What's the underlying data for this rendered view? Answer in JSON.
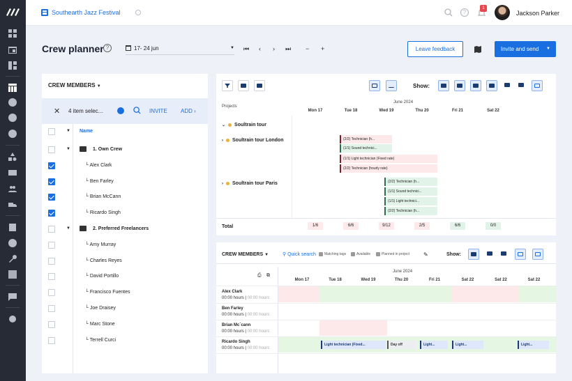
{
  "topbar": {
    "app_title": "Southearth Jazz Festival",
    "notifications": "1",
    "user_name": "Jackson Parker"
  },
  "header": {
    "title": "Crew planner",
    "date_range": "17- 24 jun",
    "nav": [
      "⏮",
      "‹",
      "›",
      "⏭",
      "−",
      "+"
    ],
    "feedback_label": "Leave feedback",
    "invite_label": "Invite and send"
  },
  "crew_panel": {
    "title": "CREW MEMBERS",
    "selection_text": "4 item selec...",
    "invite_label": "INVITE",
    "add_label": "ADD",
    "column_name": "Name",
    "rows": [
      {
        "label": "1. Own Crew",
        "group": true,
        "checked": false
      },
      {
        "label": "└ Alex Clark",
        "group": false,
        "checked": true
      },
      {
        "label": "└ Ben Farley",
        "group": false,
        "checked": true
      },
      {
        "label": "└ Brian McCann",
        "group": false,
        "checked": true
      },
      {
        "label": "└ Ricardo Singh",
        "group": false,
        "checked": true
      },
      {
        "label": "2. Preferred Freelancers",
        "group": true,
        "checked": false
      },
      {
        "label": "└ Amy Murray",
        "group": false,
        "checked": false
      },
      {
        "label": "└ Charles Reyes",
        "group": false,
        "checked": false
      },
      {
        "label": "└ David Portillo",
        "group": false,
        "checked": false
      },
      {
        "label": "└ Francisco Fuentes",
        "group": false,
        "checked": false
      },
      {
        "label": "└ Joe Draisey",
        "group": false,
        "checked": false
      },
      {
        "label": "└ Marc Stone",
        "group": false,
        "checked": false
      },
      {
        "label": "└ Terrell Curci",
        "group": false,
        "checked": false
      }
    ]
  },
  "projects_panel": {
    "show_label": "Show:",
    "projects_label": "Projects",
    "month": "June 2024",
    "days": [
      "Mon 17",
      "Tue 18",
      "Wed 19",
      "Thu 20",
      "Fri 21",
      "Sat 22"
    ],
    "projects": [
      "Soultrain tour",
      "Soultrain tour London",
      "Soultrain tour Paris"
    ],
    "london_bars": [
      "(2/2) Technician (h...",
      "(1/1) Sound technici...",
      "(1/1) Light technician (Fixed rate)",
      "(2/2) Technician (hourly rate)"
    ],
    "paris_bars": [
      "(2/2) Technician (h...",
      "(1/1) Sound technici...",
      "(1/1) Light technici...",
      "(2/2) Technician (h..."
    ],
    "total_label": "Total",
    "totals": [
      "1/6",
      "6/6",
      "9/12",
      "2/5",
      "6/6",
      "0/0"
    ]
  },
  "crew_schedule": {
    "title": "CREW MEMBERS",
    "quick_search": "Quick search",
    "tags": [
      "Matching tags",
      "Available",
      "Planned in project"
    ],
    "show_label": "Show:",
    "month": "June 2024",
    "days": [
      "Mon 17",
      "Tue 18",
      "Wed 19",
      "Thu 20",
      "Fri 21",
      "Sat 22",
      "Sat 22",
      "Sat 22"
    ],
    "hours_value": "00:00 hours",
    "hours_planned": "00:00 hours",
    "members": [
      "Alex Clark",
      "Ben Farley",
      "Brian Mc`cann",
      "Ricardo Singh"
    ],
    "bars": [
      "Light technician (Fixed...",
      "Day off",
      "Light...",
      "Light...",
      "Light..."
    ]
  }
}
